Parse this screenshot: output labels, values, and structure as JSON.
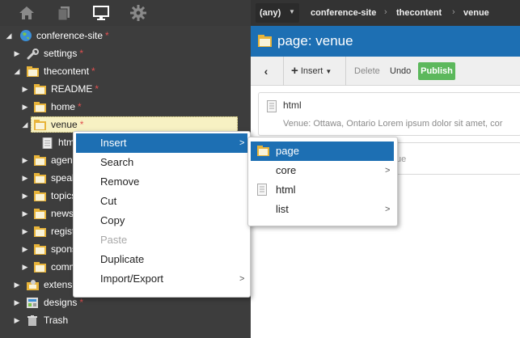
{
  "sidebar": {
    "toolbar_icons": [
      "home-icon",
      "pages-icon",
      "monitor-icon",
      "gear-icon"
    ],
    "tree": [
      {
        "label": "conference-site",
        "starred": true,
        "icon": "globe-icon",
        "arrow": "down"
      },
      {
        "label": "settings",
        "starred": true,
        "icon": "wrench-icon",
        "arrow": "right"
      },
      {
        "label": "thecontent",
        "starred": true,
        "icon": "folder-icon",
        "arrow": "down"
      },
      {
        "label": "README",
        "starred": true,
        "icon": "folder-icon",
        "arrow": "right"
      },
      {
        "label": "home",
        "starred": true,
        "icon": "folder-icon",
        "arrow": "right"
      },
      {
        "label": "venue",
        "starred": true,
        "icon": "folder-icon",
        "arrow": "down",
        "selected": true
      },
      {
        "label": "html",
        "starred": false,
        "icon": "document-icon",
        "arrow": ""
      },
      {
        "label": "agenda",
        "starred": false,
        "icon": "folder-icon",
        "arrow": "right"
      },
      {
        "label": "speakers",
        "starred": false,
        "icon": "folder-icon",
        "arrow": "right"
      },
      {
        "label": "topics",
        "starred": false,
        "icon": "folder-icon",
        "arrow": "right"
      },
      {
        "label": "news",
        "starred": false,
        "icon": "folder-icon",
        "arrow": "right"
      },
      {
        "label": "register",
        "starred": false,
        "icon": "folder-icon",
        "arrow": "right"
      },
      {
        "label": "sponsors",
        "starred": false,
        "icon": "folder-icon",
        "arrow": "right"
      },
      {
        "label": "community",
        "starred": false,
        "icon": "folder-icon",
        "arrow": "right"
      },
      {
        "label": "extensions",
        "starred": false,
        "icon": "extensions-icon",
        "arrow": "right"
      },
      {
        "label": "designs",
        "starred": true,
        "icon": "designs-icon",
        "arrow": "right"
      },
      {
        "label": "Trash",
        "starred": false,
        "icon": "trash-icon",
        "arrow": "right"
      }
    ]
  },
  "breadcrumb": {
    "filter_value": "(any)",
    "items": [
      "conference-site",
      "thecontent",
      "venue"
    ]
  },
  "page_header": {
    "title": "page: venue"
  },
  "actions": {
    "insert_label": "Insert",
    "delete_label": "Delete",
    "undo_label": "Undo",
    "publish_label": "Publish"
  },
  "content": {
    "card1_title": "html",
    "card1_subtitle": "Venue: Ottawa, Ontario Lorem ipsum dolor sit amet, cor",
    "card2_text": "ue"
  },
  "context_menu": {
    "items": [
      {
        "label": "Insert",
        "has_submenu": true,
        "highlighted": true
      },
      {
        "label": "Search"
      },
      {
        "label": "Remove"
      },
      {
        "label": "Cut"
      },
      {
        "label": "Copy"
      },
      {
        "label": "Paste",
        "disabled": true
      },
      {
        "label": "Duplicate"
      },
      {
        "label": "Import/Export",
        "has_submenu": true
      }
    ]
  },
  "insert_submenu": {
    "items": [
      {
        "label": "page",
        "icon": "folder-icon",
        "highlighted": true
      },
      {
        "label": "core",
        "has_submenu": true
      },
      {
        "label": "html",
        "icon": "document-icon"
      },
      {
        "label": "list",
        "has_submenu": true
      }
    ]
  },
  "colors": {
    "sidebar_bg": "#3d3d3d",
    "accent_blue": "#1d6fb3",
    "publish_green": "#5cb85c",
    "star_red": "#e05050",
    "selected_row_bg": "#f7f1c3"
  }
}
